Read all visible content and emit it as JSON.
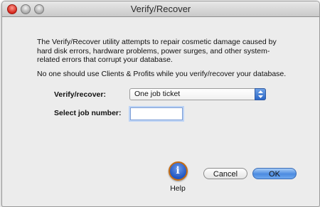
{
  "window": {
    "title": "Verify/Recover"
  },
  "description": "The Verify/Recover utility attempts to repair cosmetic damage caused by hard disk errors, hardware problems, power surges, and other system-related errors that corrupt your database.",
  "warning": "No one should use Clients & Profits while you verify/recover your database.",
  "form": {
    "verify_label": "Verify/recover:",
    "verify_value": "One job ticket",
    "job_number_label": "Select job number:",
    "job_number_value": ""
  },
  "buttons": {
    "help_label": "Help",
    "cancel_label": "Cancel",
    "ok_label": "OK"
  },
  "icons": {
    "help": "info-icon",
    "select_arrows": "up-down-arrows-icon"
  },
  "colors": {
    "ok_button": "#4c8be0",
    "close_button": "#d4261c",
    "help_ring": "#c56b10"
  }
}
